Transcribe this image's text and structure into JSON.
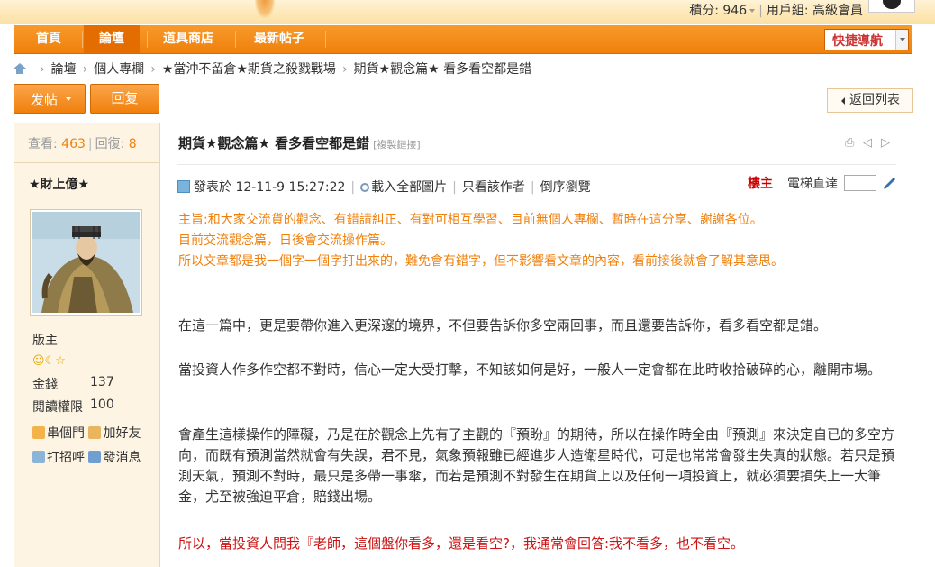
{
  "header": {
    "points_label": "積分: 946",
    "group_label": "用戶組: 高級會員"
  },
  "nav": {
    "items": [
      "首頁",
      "論壇",
      "道具商店",
      "最新帖子"
    ],
    "quick_nav": "快捷導航"
  },
  "breadcrumb": [
    "論壇",
    "個人專欄",
    "★當沖不留倉★期貨之殺戮戰場",
    "期貨★觀念篇★ 看多看空都是錯"
  ],
  "actions": {
    "post": "发帖",
    "reply": "回复",
    "back": "返回列表"
  },
  "stats": {
    "views_label": "查看:",
    "views": "463",
    "replies_label": "回復:",
    "replies": "8"
  },
  "author": {
    "name": "★財上億★",
    "rank": "版主",
    "money_label": "金錢",
    "money": "137",
    "permission_label": "閱讀權限",
    "permission": "100",
    "links": [
      "串個門",
      "加好友",
      "打招呼",
      "發消息"
    ]
  },
  "post": {
    "title": "期貨★觀念篇★ 看多看空都是錯",
    "copy_link": "[複製鏈接]",
    "posted": "發表於 12-11-9 15:27:22",
    "meta_links": [
      "載入全部圖片",
      "只看該作者",
      "倒序瀏覽"
    ],
    "floor": "樓主",
    "elevator": "電梯直達",
    "notice": [
      "主旨:和大家交流貨的觀念、有錯請糾正、有對可相互學習、目前無個人專欄、暫時在這分享、謝謝各位。",
      "目前交流觀念篇，日後會交流操作篇。",
      "所以文章都是我一個字一個字打出來的，難免會有錯字，但不影響看文章的內容，看前接後就會了解其意思。"
    ],
    "paragraphs": [
      "在這一篇中，更是要帶你進入更深邃的境界，不但要告訴你多空兩回事，而且還要告訴你，看多看空都是錯。",
      "當投資人作多作空都不對時，信心一定大受打擊，不知該如何是好，一般人一定會都在此時收拾破碎的心，離開市場。",
      "會產生這樣操作的障礙，乃是在於觀念上先有了主觀的『預盼』的期待，所以在操作時全由『預測』來決定自已的多空方向，而既有預測當然就會有失誤，君不見，氣象預報雖已經進步人造衛星時代，可是也常常會發生失真的狀態。若只是預測天氣，預測不對時，最只是多帶一事傘，而若是預測不對發生在期貨上以及任何一項投資上，就必須要損失上一大筆金，尤至被強迫平倉，賠錢出場。"
    ],
    "last_paragraph": "所以，當投資人問我『老師，這個盤你看多，還是看空?，我通常會回答:我不看多，也不看空。"
  },
  "colors": {
    "accent": "#f0800c",
    "notice": "#f0800c",
    "highlight": "#cc1111"
  }
}
